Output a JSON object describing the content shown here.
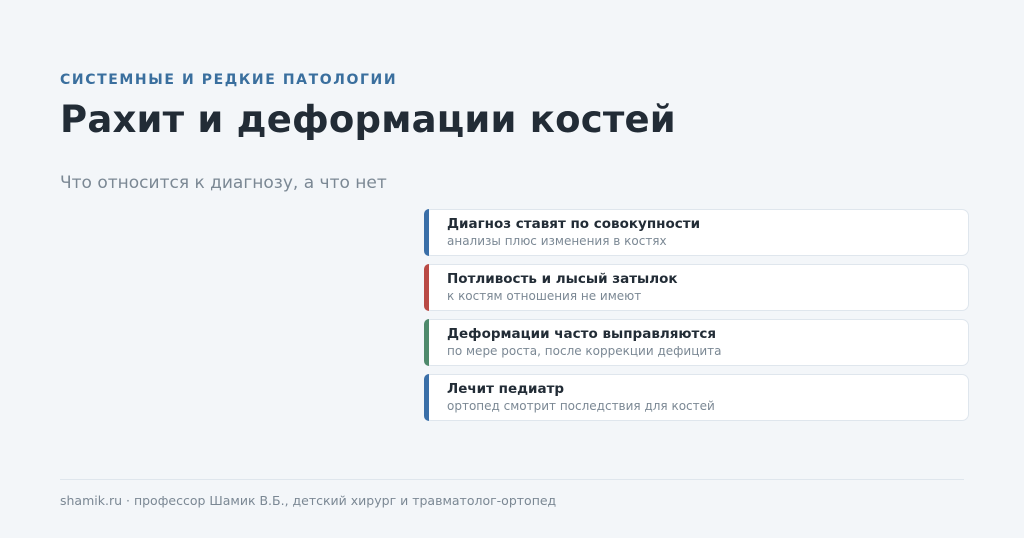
{
  "header": {
    "eyebrow": "СИСТЕМНЫЕ И РЕДКИЕ ПАТОЛОГИИ",
    "title": "Рахит и деформации костей",
    "subtitle": "Что относится к диагнозу, а что нет"
  },
  "cards": [
    {
      "title": "Диагноз ставят по совокупности",
      "text": "анализы плюс изменения в костях",
      "color": "#3a6fa8"
    },
    {
      "title": "Потливость и лысый затылок",
      "text": "к костям отношения не имеют",
      "color": "#b94a45"
    },
    {
      "title": "Деформации часто выправляются",
      "text": "по мере роста, после коррекции дефицита",
      "color": "#4e8a6c"
    },
    {
      "title": "Лечит педиатр",
      "text": "ортопед смотрит последствия для костей",
      "color": "#3a6fa8"
    }
  ],
  "footer": {
    "text": "shamik.ru · профессор Шамик В.Б., детский хирург и травматолог-ортопед"
  }
}
